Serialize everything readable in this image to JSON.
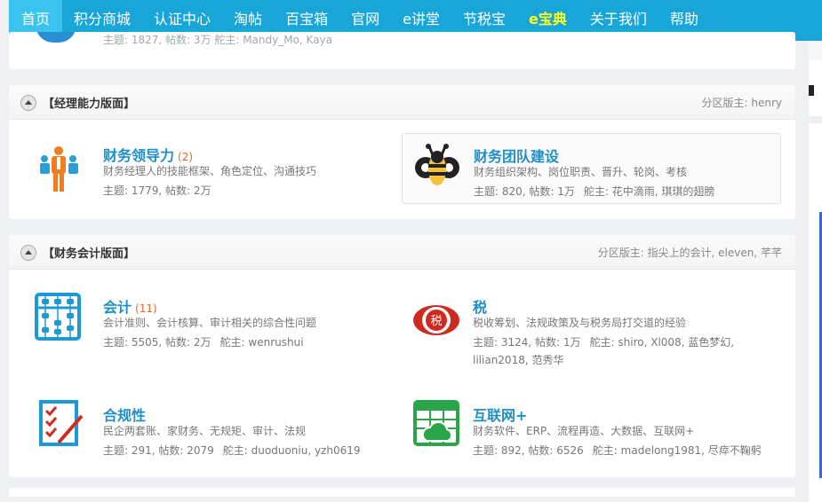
{
  "nav": {
    "items": [
      "首页",
      "积分商城",
      "认证中心",
      "淘帖",
      "百宝箱",
      "官网",
      "e讲堂",
      "节税宝",
      "e宝典",
      "关于我们",
      "帮助"
    ]
  },
  "top_card": {
    "text": "主题: 1827, 帖数: 3万   舵主: Mandy_Mo, Kaya"
  },
  "sections": [
    {
      "title": "【经理能力版面】",
      "moderators": "分区版主: henry",
      "forums": [
        {
          "name": "财务领导力",
          "count": "(2)",
          "desc": "财务经理人的技能框架、角色定位、沟通技巧",
          "stat": "主题: 1779, 帖数: 2万",
          "mods": "",
          "icon": "leadership-icon"
        },
        {
          "name": "财务团队建设",
          "count": "",
          "desc": "财务组织架构、岗位职责、晋升、轮岗、考核",
          "stat": "主题: 820, 帖数: 1万",
          "mods": "舵主: 花中滴雨, 琪琪的翅膀",
          "icon": "bee-icon"
        }
      ]
    },
    {
      "title": "【财务会计版面】",
      "moderators": "分区版主: 指尖上的会计, eleven, 芊芊",
      "forums": [
        {
          "name": "会计",
          "count": "(11)",
          "desc": "会计准则、会计核算、审计相关的综合性问题",
          "stat": "主题: 5505, 帖数: 2万",
          "mods": "舵主: wenrushui",
          "icon": "abacus-icon"
        },
        {
          "name": "税",
          "count": "",
          "desc": "税收筹划、法规政策及与税务局打交道的经验",
          "stat": "主题: 3124, 帖数: 1万",
          "mods": "舵主: shiro, Xl008, 蓝色梦幻, lilian2018, 范秀华",
          "icon": "tax-emblem-icon"
        },
        {
          "name": "合规性",
          "count": "",
          "desc": "民企两套账、家财务、无规矩、审计、法规",
          "stat": "主题: 291, 帖数: 2079",
          "mods": "舵主: duoduoniu, yzh0619",
          "icon": "checklist-icon"
        },
        {
          "name": "互联网+",
          "count": "",
          "desc": "财务软件、ERP、流程再造、大数据、互联网+",
          "stat": "主题: 892, 帖数: 6526",
          "mods": "舵主: madelong1981, 尽瘁不鞠躬",
          "icon": "cloud-sheet-icon"
        }
      ]
    }
  ],
  "colors": {
    "nav": "#18a6d9",
    "nav_active": "#3cc2ee",
    "link": "#1f8fc8",
    "count": "#e06a2d"
  }
}
